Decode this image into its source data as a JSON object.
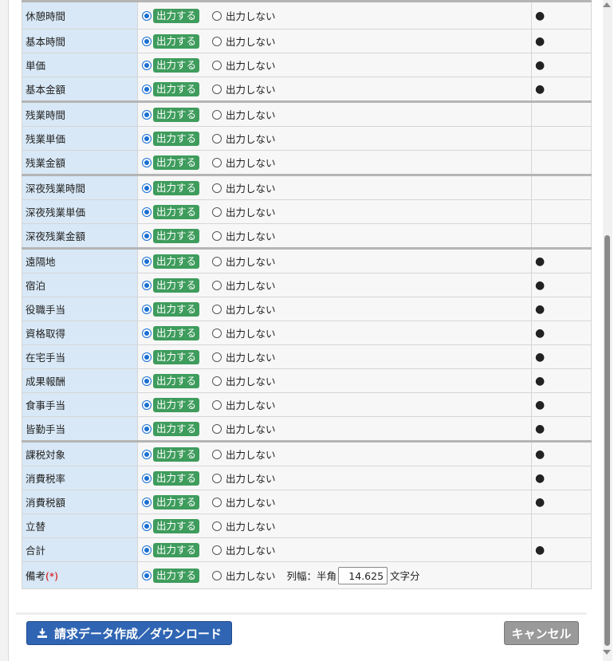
{
  "options": {
    "on_label": "出力する",
    "off_label": "出力しない",
    "mark_symbol": "●"
  },
  "rows": [
    {
      "label": "休憩時間",
      "mark": true
    },
    {
      "label": "基本時間",
      "mark": true
    },
    {
      "label": "単価",
      "mark": true
    },
    {
      "label": "基本金額",
      "mark": true
    },
    {
      "label": "残業時間",
      "mark": false,
      "group_start": true
    },
    {
      "label": "残業単価",
      "mark": false
    },
    {
      "label": "残業金額",
      "mark": false
    },
    {
      "label": "深夜残業時間",
      "mark": false,
      "group_start": true
    },
    {
      "label": "深夜残業単価",
      "mark": false
    },
    {
      "label": "深夜残業金額",
      "mark": false
    },
    {
      "label": "遠隔地",
      "mark": true,
      "group_start": true
    },
    {
      "label": "宿泊",
      "mark": true
    },
    {
      "label": "役職手当",
      "mark": true
    },
    {
      "label": "資格取得",
      "mark": true
    },
    {
      "label": "在宅手当",
      "mark": true
    },
    {
      "label": "成果報酬",
      "mark": true
    },
    {
      "label": "食事手当",
      "mark": true
    },
    {
      "label": "皆勤手当",
      "mark": true
    },
    {
      "label": "課税対象",
      "mark": true,
      "group_start": true
    },
    {
      "label": "消費税率",
      "mark": true
    },
    {
      "label": "消費税額",
      "mark": true
    },
    {
      "label": "立替",
      "mark": false
    },
    {
      "label": "合計",
      "mark": true
    }
  ],
  "remarks_row": {
    "label": "備考",
    "required": "(*)",
    "width_label": "列幅：半角",
    "width_value": "14.625",
    "unit_label": "文字分"
  },
  "footer": {
    "download_label": "請求データ作成／ダウンロード",
    "cancel_label": "キャンセル"
  }
}
